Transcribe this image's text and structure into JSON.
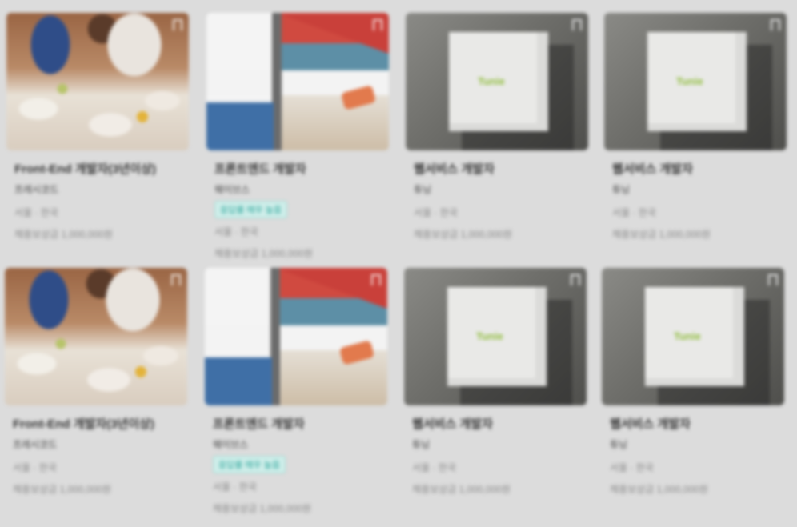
{
  "cards": [
    {
      "title": "Front-End 개발자(3년이상)",
      "company": "프레시코드",
      "tag": "",
      "location": "서울 · 한국",
      "reward": "채용보상금 1,000,000원",
      "image": "restaurant-photo"
    },
    {
      "title": "프론트엔드 개발자",
      "company": "웨이브스",
      "tag": "응답률 매우 높음",
      "location": "서울 · 한국",
      "reward": "채용보상금 1,000,000원",
      "image": "office-photo"
    },
    {
      "title": "웹서비스 개발자",
      "company": "튜닝",
      "tag": "",
      "location": "서울 · 한국",
      "reward": "채용보상금 1,000,000원",
      "image": "tunie-box-photo",
      "logo": "Tunie"
    },
    {
      "title": "웹서비스 개발자",
      "company": "튜닝",
      "tag": "",
      "location": "서울 · 한국",
      "reward": "채용보상금 1,000,000원",
      "image": "tunie-box-photo",
      "logo": "Tunie"
    },
    {
      "title": "Front-End 개발자(3년이상)",
      "company": "프레시코드",
      "tag": "",
      "location": "서울 · 한국",
      "reward": "채용보상금 1,000,000원",
      "image": "restaurant-photo"
    },
    {
      "title": "프론트엔드 개발자",
      "company": "웨이브스",
      "tag": "응답률 매우 높음",
      "location": "서울 · 한국",
      "reward": "채용보상금 1,000,000원",
      "image": "office-photo"
    },
    {
      "title": "웹서비스 개발자",
      "company": "튜닝",
      "tag": "",
      "location": "서울 · 한국",
      "reward": "채용보상금 1,000,000원",
      "image": "tunie-box-photo",
      "logo": "Tunie"
    },
    {
      "title": "웹서비스 개발자",
      "company": "튜닝",
      "tag": "",
      "location": "서울 · 한국",
      "reward": "채용보상금 1,000,000원",
      "image": "tunie-box-photo",
      "logo": "Tunie"
    }
  ],
  "colors": {
    "background": "#dcdcdc",
    "tag_text": "#2ba59a",
    "tag_bg": "#cfeeea"
  },
  "icons": {
    "bookmark": "bookmark-icon"
  }
}
